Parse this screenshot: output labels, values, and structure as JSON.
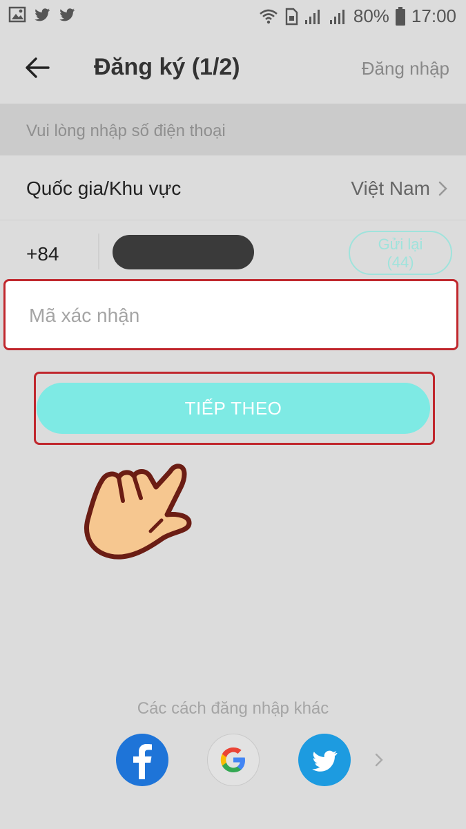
{
  "status_bar": {
    "battery": "80%",
    "time": "17:00"
  },
  "header": {
    "title": "Đăng ký (1/2)",
    "login_link": "Đăng nhập"
  },
  "hint": "Vui lòng nhập số điện thoại",
  "country": {
    "label": "Quốc gia/Khu vực",
    "value": "Việt Nam"
  },
  "phone": {
    "code": "+84",
    "resend_label": "Gửi lại",
    "resend_count": "(44)"
  },
  "verify": {
    "placeholder": "Mã xác nhận",
    "value": ""
  },
  "next_button": "TIẾP THEO",
  "other": {
    "label": "Các cách đăng nhập khác"
  },
  "colors": {
    "accent": "#7eeae4",
    "highlight": "#c0272d",
    "facebook": "#1e74d8",
    "twitter": "#1d9be0"
  },
  "icons": [
    "image-icon",
    "twitter-icon",
    "wifi-icon",
    "sim-icon",
    "signal-icon",
    "battery-icon",
    "back-arrow-icon",
    "chevron-right-icon",
    "hand-pointer-icon",
    "facebook-icon",
    "google-icon"
  ]
}
